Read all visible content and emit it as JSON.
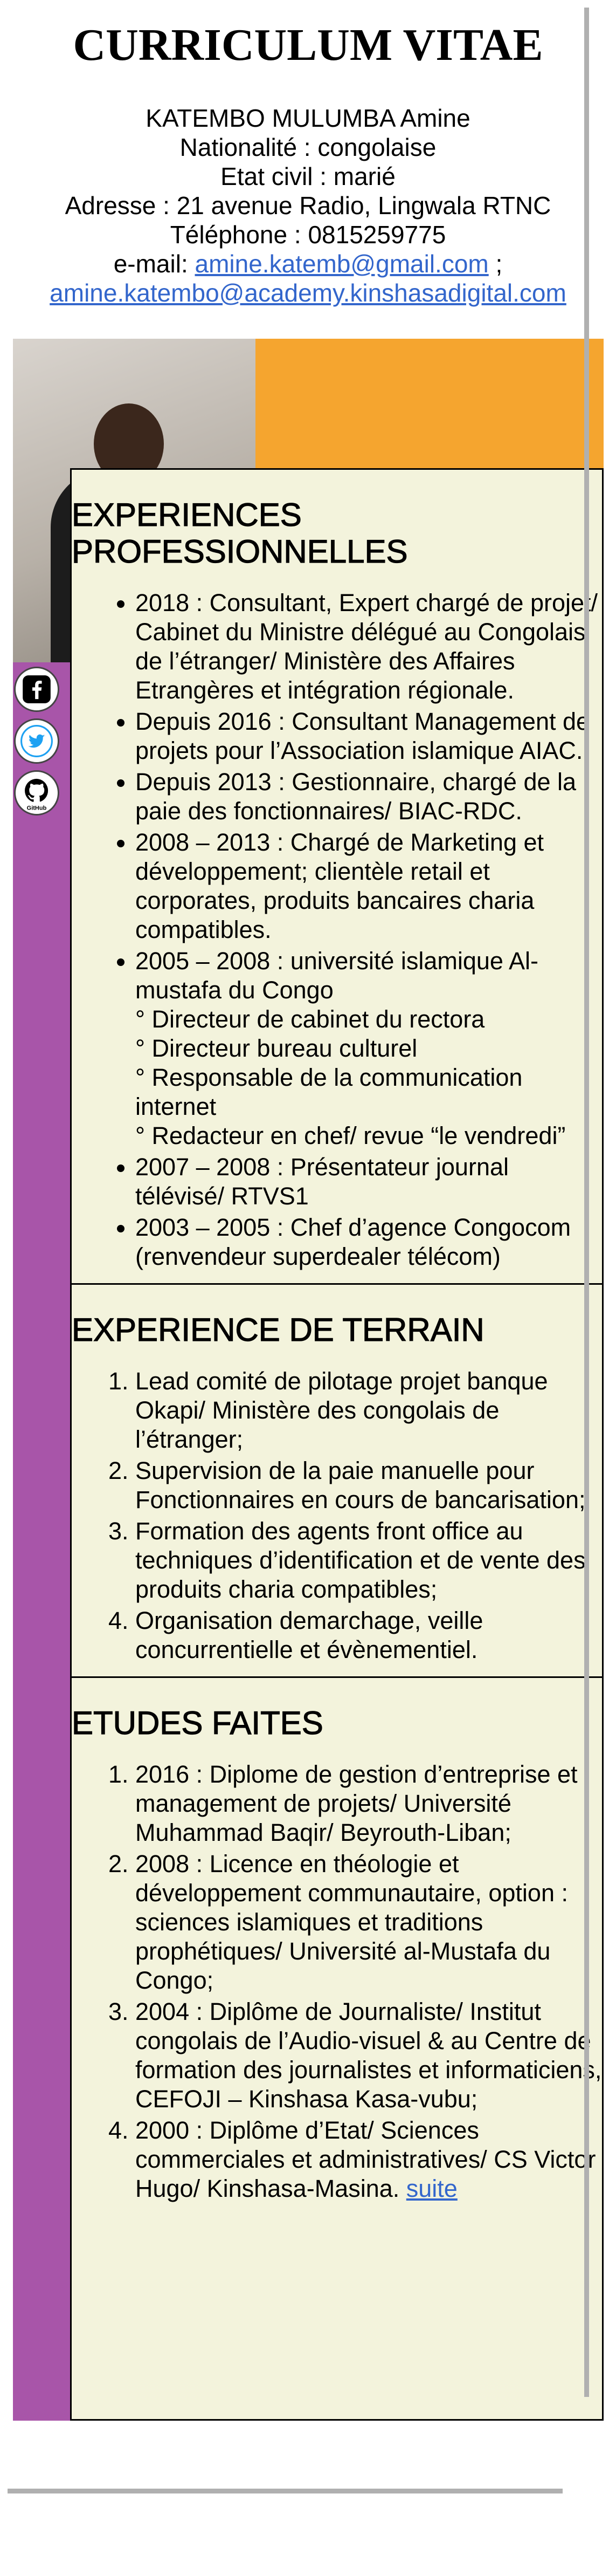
{
  "header": {
    "title": "CURRICULUM VITAE",
    "name": "KATEMBO MULUMBA Amine",
    "nationality": "Nationalité : congolaise",
    "civil_status": "Etat civil : marié",
    "address": "Adresse : 21 avenue Radio, Lingwala RTNC",
    "phone": "Téléphone : 0815259775",
    "email_label": "e-mail: ",
    "email_1": "amine.katemb@gmail.com",
    "email_sep": " ;",
    "email_2": "amine.katembo@academy.kinshasadigital.com"
  },
  "social": [
    {
      "icon": "facebook-icon",
      "label": "facebook",
      "color": "#000000"
    },
    {
      "icon": "twitter-icon",
      "label": "twitter",
      "color": "#1da1f2"
    },
    {
      "icon": "github-icon",
      "label": "GitHub",
      "color": "#000000"
    }
  ],
  "colors": {
    "orange": "#f5a52f",
    "purple": "#a855a9",
    "content_bg": "#f3f3dc",
    "link": "#3366cc"
  },
  "experiences": {
    "heading": "EXPERIENCES PROFESSIONNELLES",
    "items": [
      "2018 : Consultant, Expert chargé de projet/ Cabinet du Ministre délégué au Congolais de l’étranger/ Ministère des Affaires Etrangères et intégration régionale.",
      "Depuis 2016 : Consultant Management de projets pour l’Association islamique AIAC.",
      "Depuis 2013 : Gestionnaire, chargé de la paie des fonctionnaires/ BIAC-RDC.",
      "2008 – 2013 : Chargé de Marketing et développement; clientèle retail et corporates, produits bancaires charia compatibles.",
      "2005 – 2008 : université islamique Al-mustafa du Congo",
      "2007 – 2008 : Présentateur journal télévisé/ RTVS1",
      "2003 – 2005 : Chef d’agence Congocom (renvendeur superdealer télécom)"
    ],
    "sub_items": [
      "° Directeur de cabinet du rectora",
      "° Directeur bureau culturel",
      "° Responsable de la communication internet",
      "° Redacteur en chef/ revue “le vendredi”"
    ]
  },
  "terrain": {
    "heading": "EXPERIENCE DE TERRAIN",
    "items": [
      "Lead comité de pilotage projet banque Okapi/ Ministère des congolais de l’étranger;",
      "Supervision de la paie manuelle pour Fonctionnaires en cours de bancarisation;",
      "Formation des agents front office au techniques d’identification et de vente des produits charia compatibles;",
      "Organisation demarchage, veille concurrentielle et évènementiel."
    ]
  },
  "etudes": {
    "heading": "ETUDES FAITES",
    "items": [
      "2016 : Diplome de gestion d’entreprise et management de projets/ Université Muhammad Baqir/ Beyrouth-Liban;",
      "2008 : Licence en théologie et développement communautaire, option : sciences islamiques et traditions prophétiques/ Université al-Mustafa du Congo;",
      "2004 : Diplôme de Journaliste/ Institut congolais de l’Audio-visuel & au Centre de formation des journalistes et informaticiens, CEFOJI – Kinshasa Kasa-vubu;",
      "2000 : Diplôme d’Etat/ Sciences commerciales et administratives/ CS Victor Hugo/ Kinshasa-Masina. "
    ],
    "more_link": "suite"
  }
}
